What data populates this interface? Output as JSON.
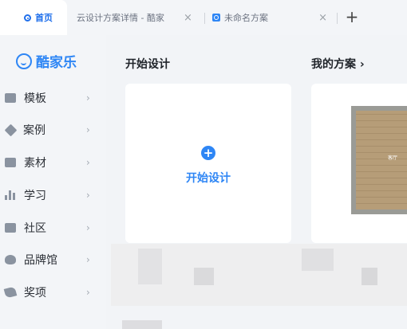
{
  "tabs": {
    "home": "首页",
    "tab2": "云设计方案详情 - 酷家",
    "tab3": "未命名方案",
    "close": "×",
    "add": "+"
  },
  "logo": "酷家乐",
  "nav": [
    {
      "label": "模板",
      "arrow": "›"
    },
    {
      "label": "案例",
      "arrow": "›"
    },
    {
      "label": "素材",
      "arrow": "›"
    },
    {
      "label": "学习",
      "arrow": "›"
    },
    {
      "label": "社区",
      "arrow": "›"
    },
    {
      "label": "品牌馆",
      "arrow": "›"
    },
    {
      "label": "奖项",
      "arrow": "›"
    }
  ],
  "main": {
    "start_title": "开始设计",
    "plans_title": "我的方案 ›",
    "start_button": "开始设计",
    "plus": "+",
    "floor_label": "客厅"
  },
  "colors": {
    "accent": "#2e86f5",
    "sidebar": "#f3f5f8"
  }
}
